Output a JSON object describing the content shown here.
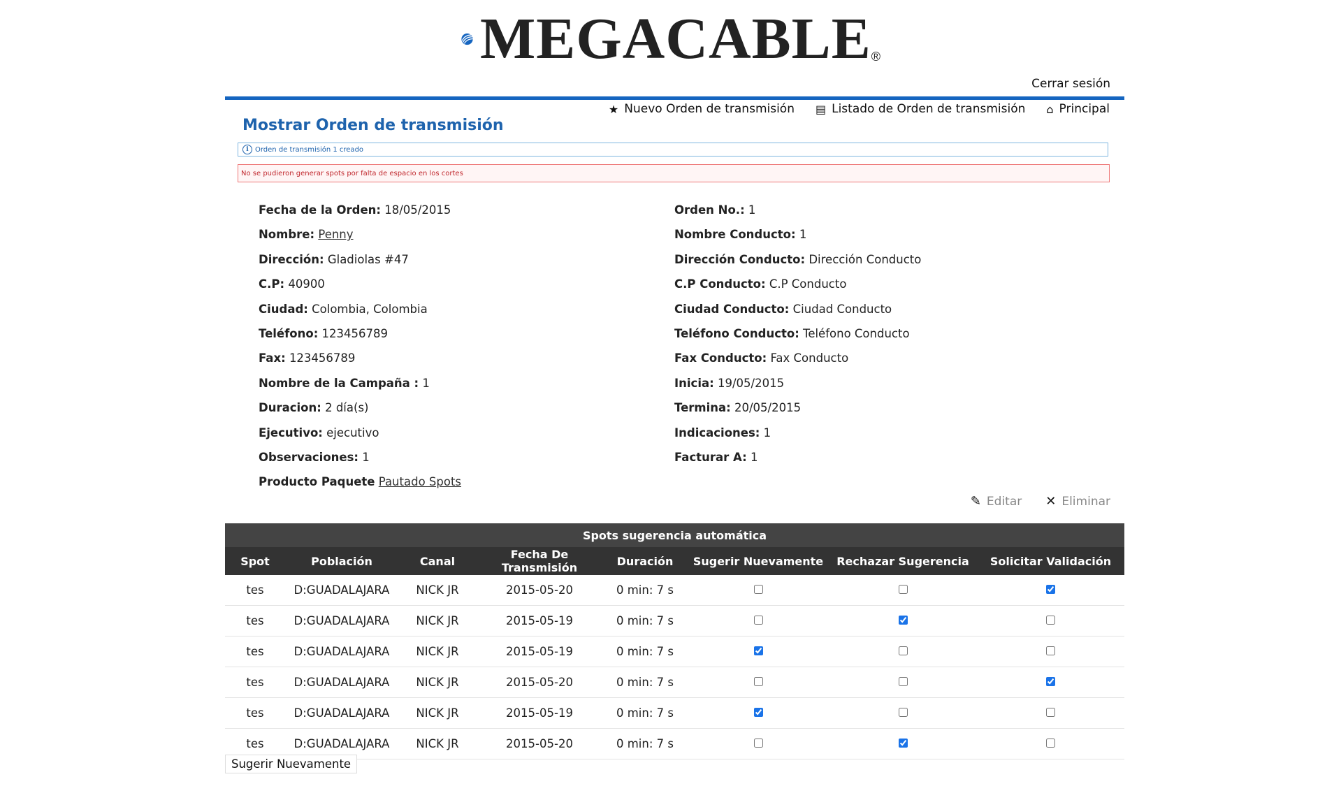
{
  "brand": {
    "name": "MEGACABLE",
    "reg": "®",
    "color": "#1565c0"
  },
  "header": {
    "logout": "Cerrar sesión"
  },
  "nav": {
    "items": [
      {
        "icon": "star-icon",
        "label": "Nuevo Orden de transmisión"
      },
      {
        "icon": "list-icon",
        "label": "Listado de Orden de transmisión"
      },
      {
        "icon": "home-icon",
        "label": "Principal"
      }
    ]
  },
  "page": {
    "title": "Mostrar Orden de transmisión",
    "info_message": "Orden de transmisión 1 creado",
    "error_message": "No se pudieron generar spots por falta de espacio en los cortes"
  },
  "details": {
    "left": [
      {
        "label": "Fecha de la Orden:",
        "value": "18/05/2015"
      },
      {
        "label": "Nombre:",
        "value": "Penny",
        "link": true
      },
      {
        "label": "Dirección:",
        "value": "Gladiolas #47"
      },
      {
        "label": "C.P:",
        "value": "40900"
      },
      {
        "label": "Ciudad:",
        "value": "Colombia, Colombia"
      },
      {
        "label": "Teléfono:",
        "value": "123456789"
      },
      {
        "label": "Fax:",
        "value": "123456789"
      },
      {
        "label": "Nombre de la Campaña :",
        "value": "1"
      },
      {
        "label": "Duracion:",
        "value": "2 día(s)"
      },
      {
        "label": "Ejecutivo:",
        "value": "ejecutivo"
      },
      {
        "label": "Observaciones:",
        "value": "1"
      },
      {
        "label": "Producto Paquete",
        "value": "Pautado Spots",
        "link": true
      }
    ],
    "right": [
      {
        "label": "Orden No.:",
        "value": "1"
      },
      {
        "label": "Nombre Conducto:",
        "value": "1"
      },
      {
        "label": "Dirección Conducto:",
        "value": "Dirección Conducto"
      },
      {
        "label": "C.P Conducto:",
        "value": "C.P Conducto"
      },
      {
        "label": "Ciudad Conducto:",
        "value": "Ciudad Conducto"
      },
      {
        "label": "Teléfono Conducto:",
        "value": "Teléfono Conducto"
      },
      {
        "label": "Fax Conducto:",
        "value": "Fax Conducto"
      },
      {
        "label": "Inicia:",
        "value": "19/05/2015"
      },
      {
        "label": "Termina:",
        "value": "20/05/2015"
      },
      {
        "label": "Indicaciones:",
        "value": "1"
      },
      {
        "label": "Facturar A:",
        "value": "1"
      }
    ]
  },
  "actions": {
    "edit": "Editar",
    "delete": "Eliminar"
  },
  "table": {
    "caption": "Spots sugerencia automática",
    "headers": [
      "Spot",
      "Población",
      "Canal",
      "Fecha De Transmisión",
      "Duración",
      "Sugerir Nuevamente",
      "Rechazar Sugerencia",
      "Solicitar Validación"
    ],
    "rows": [
      {
        "spot": "tes",
        "poblacion": "D:GUADALAJARA",
        "canal": "NICK JR",
        "fecha": "2015-05-20",
        "duracion": "0 min: 7 s",
        "sugerir": false,
        "rechazar": false,
        "validar": true
      },
      {
        "spot": "tes",
        "poblacion": "D:GUADALAJARA",
        "canal": "NICK JR",
        "fecha": "2015-05-19",
        "duracion": "0 min: 7 s",
        "sugerir": false,
        "rechazar": true,
        "validar": false
      },
      {
        "spot": "tes",
        "poblacion": "D:GUADALAJARA",
        "canal": "NICK JR",
        "fecha": "2015-05-19",
        "duracion": "0 min: 7 s",
        "sugerir": true,
        "rechazar": false,
        "validar": false
      },
      {
        "spot": "tes",
        "poblacion": "D:GUADALAJARA",
        "canal": "NICK JR",
        "fecha": "2015-05-20",
        "duracion": "0 min: 7 s",
        "sugerir": false,
        "rechazar": false,
        "validar": true
      },
      {
        "spot": "tes",
        "poblacion": "D:GUADALAJARA",
        "canal": "NICK JR",
        "fecha": "2015-05-19",
        "duracion": "0 min: 7 s",
        "sugerir": true,
        "rechazar": false,
        "validar": false
      },
      {
        "spot": "tes",
        "poblacion": "D:GUADALAJARA",
        "canal": "NICK JR",
        "fecha": "2015-05-20",
        "duracion": "0 min: 7 s",
        "sugerir": false,
        "rechazar": true,
        "validar": false
      }
    ]
  },
  "footer": {
    "suggest_button": "Sugerir Nuevamente"
  }
}
